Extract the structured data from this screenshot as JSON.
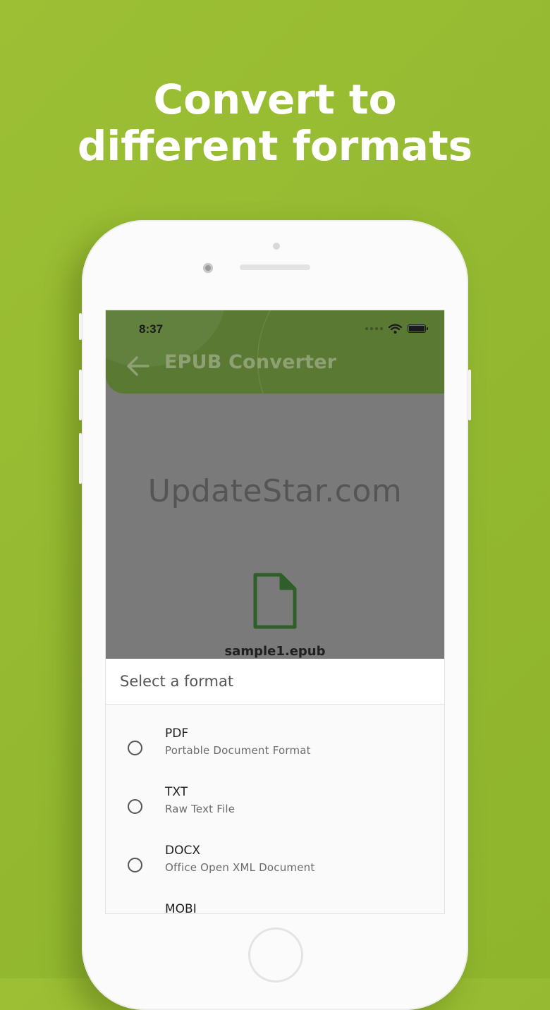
{
  "headline": {
    "line1": "Convert to",
    "line2": "different formats"
  },
  "status_bar": {
    "time": "8:37"
  },
  "app_bar": {
    "title": "EPUB Converter",
    "back_icon": "arrow-left-icon"
  },
  "content": {
    "watermark": "UpdateStar.com",
    "file_icon": "document-icon",
    "file_name": "sample1.epub"
  },
  "format_sheet": {
    "title": "Select a format",
    "options": [
      {
        "label": "PDF",
        "description": "Portable Document Format"
      },
      {
        "label": "TXT",
        "description": "Raw Text File"
      },
      {
        "label": "DOCX",
        "description": "Office Open XML Document"
      },
      {
        "label": "MOBI",
        "description": ""
      }
    ]
  },
  "colors": {
    "background": "#94b830",
    "app_bar": "#5a7a34",
    "file_icon": "#2f5e2a"
  }
}
